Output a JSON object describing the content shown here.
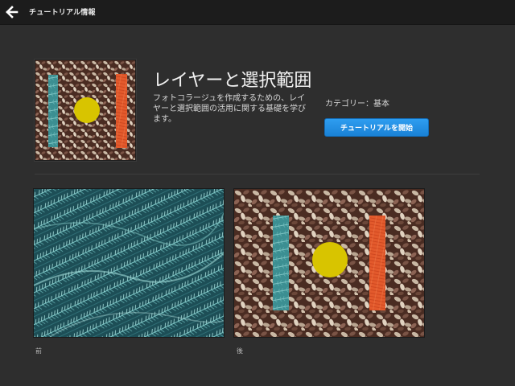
{
  "header": {
    "back_icon": "arrow-left-icon",
    "title": "チュートリアル情報"
  },
  "tutorial": {
    "title": "レイヤーと選択範囲",
    "description": "フォトコラージュを作成するための、レイヤーと選択範囲の活用に関する基礎を学びます。",
    "category": "カテゴリー：基本",
    "start_button": "チュートリアルを開始"
  },
  "preview": {
    "before_label": "前",
    "after_label": "後"
  },
  "colors": {
    "accent": "#1f8ee6",
    "background": "#2e2e2e",
    "topbar": "#1c1c1c",
    "teal_bar": "#4fb0ac",
    "orange_bar": "#e9552b",
    "yellow_circle": "#d8c400"
  }
}
